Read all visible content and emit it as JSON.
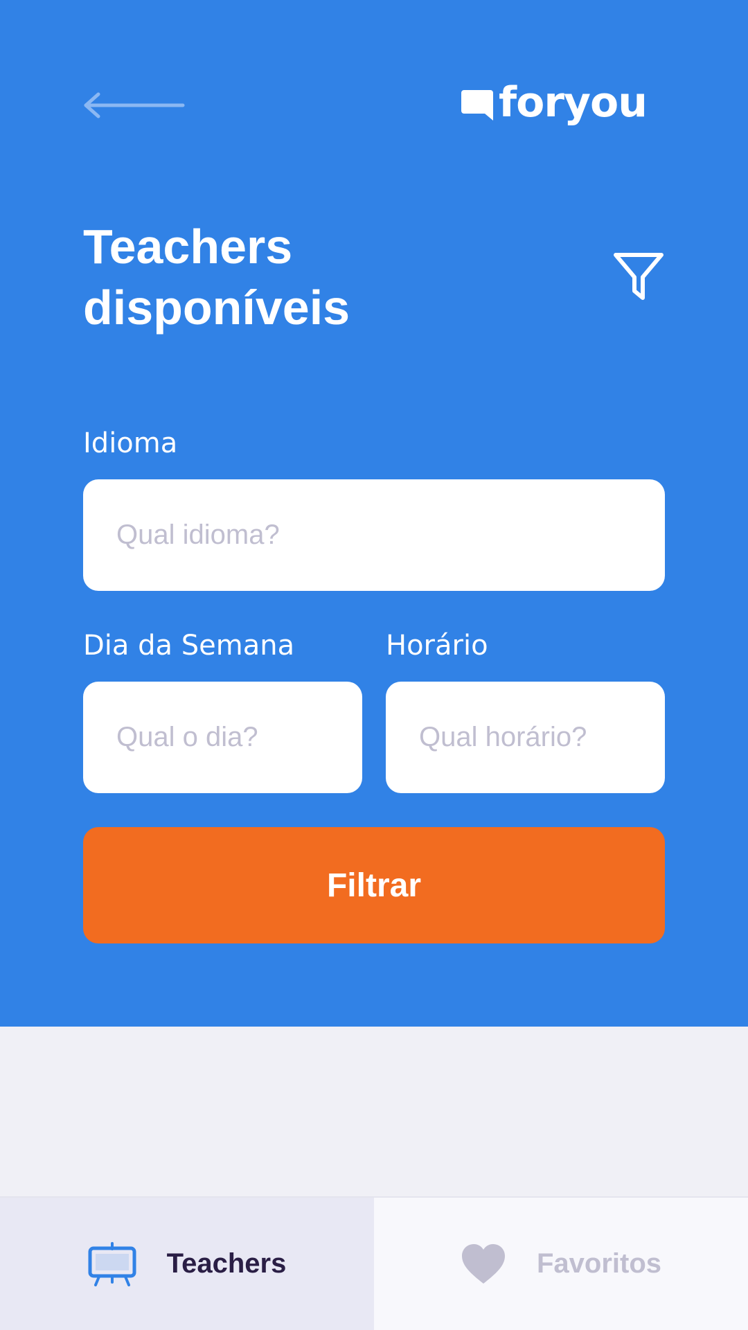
{
  "app": {
    "logo_text": "foryou"
  },
  "header": {
    "back_icon": "arrow-left-icon",
    "filter_icon": "funnel-icon",
    "title_line1": "Teachers",
    "title_line2": "disponíveis"
  },
  "filters": {
    "language": {
      "label": "Idioma",
      "placeholder": "Qual idioma?",
      "value": ""
    },
    "weekday": {
      "label": "Dia da Semana",
      "placeholder": "Qual o dia?",
      "value": ""
    },
    "time": {
      "label": "Horário",
      "placeholder": "Qual horário?",
      "value": ""
    },
    "submit_label": "Filtrar"
  },
  "tabs": [
    {
      "label": "Teachers",
      "icon": "easel-board-icon",
      "active": true
    },
    {
      "label": "Favoritos",
      "icon": "heart-icon",
      "active": false
    }
  ],
  "colors": {
    "primary": "#3182e6",
    "accent": "#f26c20",
    "background": "#f0f0f6",
    "text_dark": "#2a1e45",
    "text_muted": "#c0bed0"
  }
}
